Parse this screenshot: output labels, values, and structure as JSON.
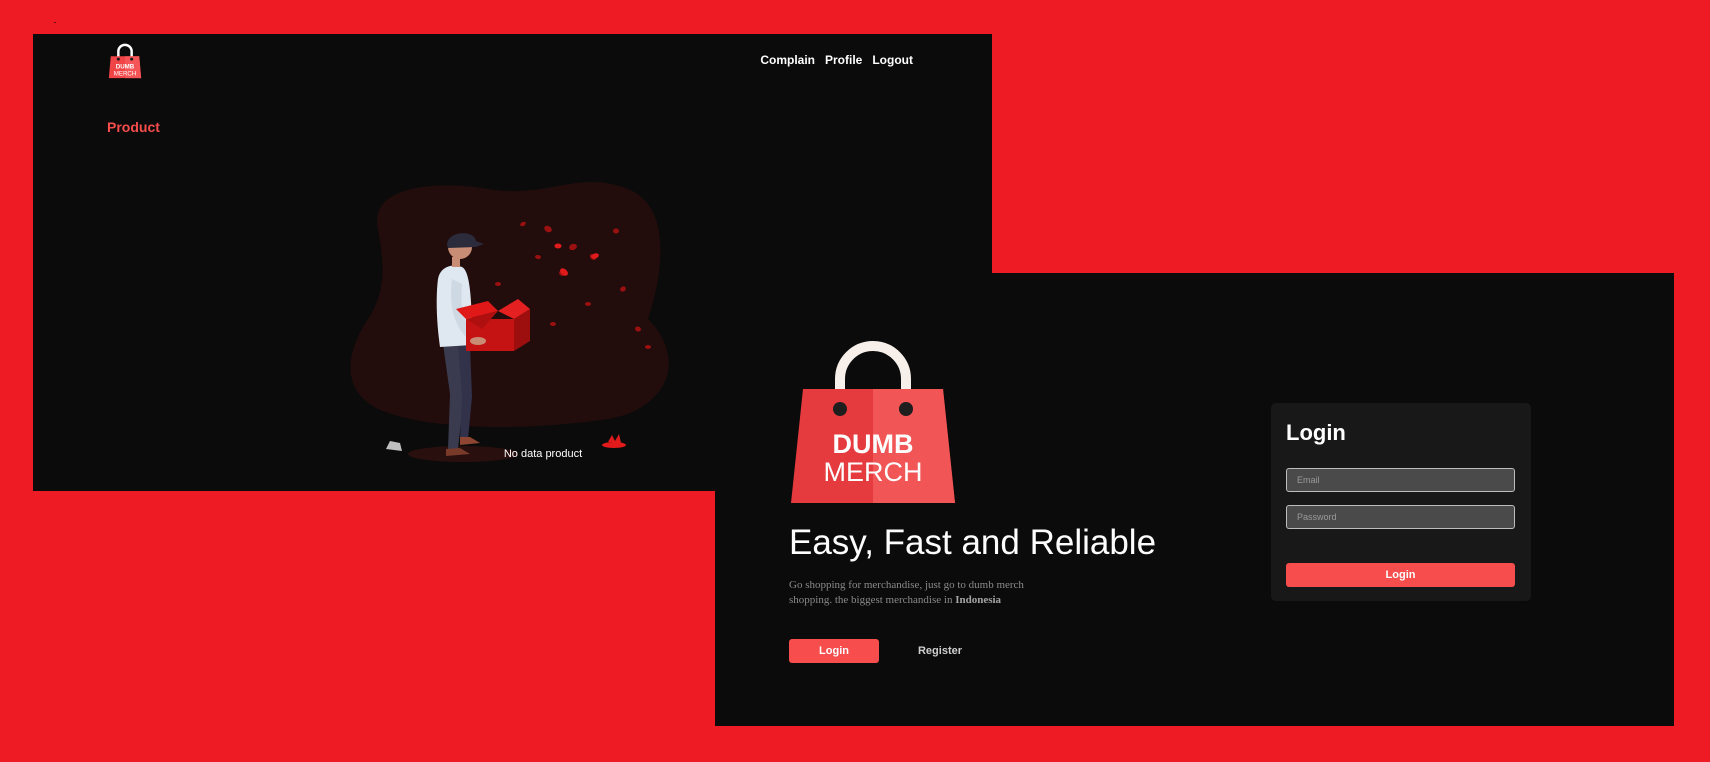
{
  "brand": {
    "logo_line1": "DUMB",
    "logo_line2": "MERCH",
    "primary_color": "#f74d4d",
    "background_color": "#ef1b24",
    "panel_color": "#0b0b0b"
  },
  "product_page": {
    "nav": {
      "complain": "Complain",
      "profile": "Profile",
      "logout": "Logout"
    },
    "section_title": "Product",
    "empty_message": "No data product",
    "illustration_icon": "empty-box-illustration"
  },
  "landing_page": {
    "title": "Easy, Fast and Reliable",
    "description_text": "Go shopping for merchandise, just go to dumb merch shopping. the biggest merchandise in ",
    "description_highlight": "Indonesia",
    "login_button": "Login",
    "register_button": "Register",
    "login_form": {
      "heading": "Login",
      "email_placeholder": "Email",
      "password_placeholder": "Password",
      "submit_label": "Login"
    }
  }
}
